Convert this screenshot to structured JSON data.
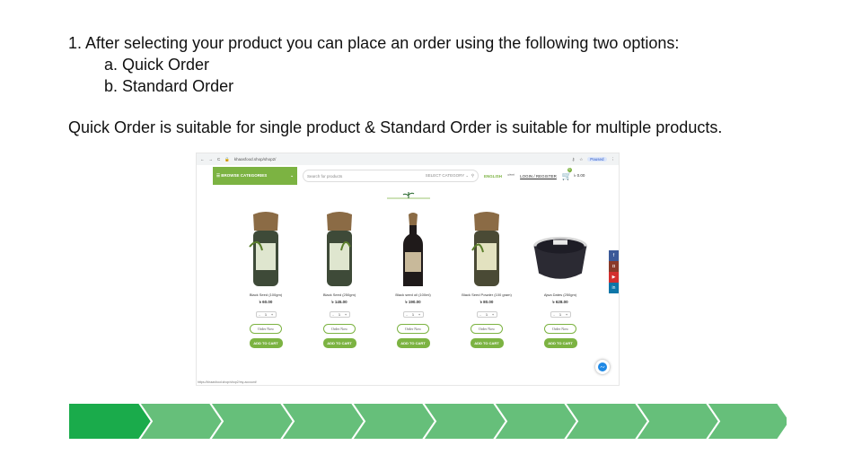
{
  "instructions": {
    "line1": "1. After selecting your product you can place an order using the following two options:",
    "option_a": "a. Quick Order",
    "option_b": "b. Standard Order",
    "note": "Quick Order is suitable for single product & Standard Order is suitable for multiple products."
  },
  "browser": {
    "url": "khaasfood.shop/shop2/",
    "paused_label": "Paused"
  },
  "site": {
    "browse_label": "BROWSE CATEGORIES",
    "search_placeholder": "Search for products",
    "select_category": "SELECT CATEGORY",
    "lang_english": "ENGLISH",
    "lang_bangla": "বাংলা",
    "login_label": "LOGIN / REGISTER",
    "cart_count": "0",
    "cart_total": "৳ 0.00",
    "status_url": "https://khaasfood.shop/shop2/my-account/"
  },
  "products": [
    {
      "name": "Black Seed (100gm)",
      "price": "৳ 60.00",
      "qty": "1",
      "order_label": "Order Now",
      "cart_label": "ADD TO CART"
    },
    {
      "name": "Black Seed (250gm)",
      "price": "৳ 145.00",
      "qty": "1",
      "order_label": "Order Now",
      "cart_label": "ADD TO CART"
    },
    {
      "name": "Black seed oil (100ml)",
      "price": "৳ 190.00",
      "qty": "1",
      "order_label": "Order Now",
      "cart_label": "ADD TO CART"
    },
    {
      "name": "Black Seed Powder (100 gram)",
      "price": "৳ 80.00",
      "qty": "1",
      "order_label": "Order Now",
      "cart_label": "ADD TO CART"
    },
    {
      "name": "Ajwa Dates (250gm)",
      "price": "৳ 628.00",
      "qty": "1",
      "order_label": "Order Now",
      "cart_label": "ADD TO CART"
    }
  ],
  "social": [
    {
      "icon": "facebook-icon",
      "glyph": "f",
      "color": "#3b5998"
    },
    {
      "icon": "instagram-icon",
      "glyph": "◘",
      "color": "#8a3a2a"
    },
    {
      "icon": "youtube-icon",
      "glyph": "▶",
      "color": "#d32f2f"
    },
    {
      "icon": "linkedin-icon",
      "glyph": "in",
      "color": "#0e76a8"
    }
  ],
  "colors": {
    "accent_green": "#7cb342",
    "progress_active": "#1aab4b",
    "progress_inactive": "#66bf7a"
  },
  "progress": {
    "total_steps": 10,
    "current_step": 1
  }
}
